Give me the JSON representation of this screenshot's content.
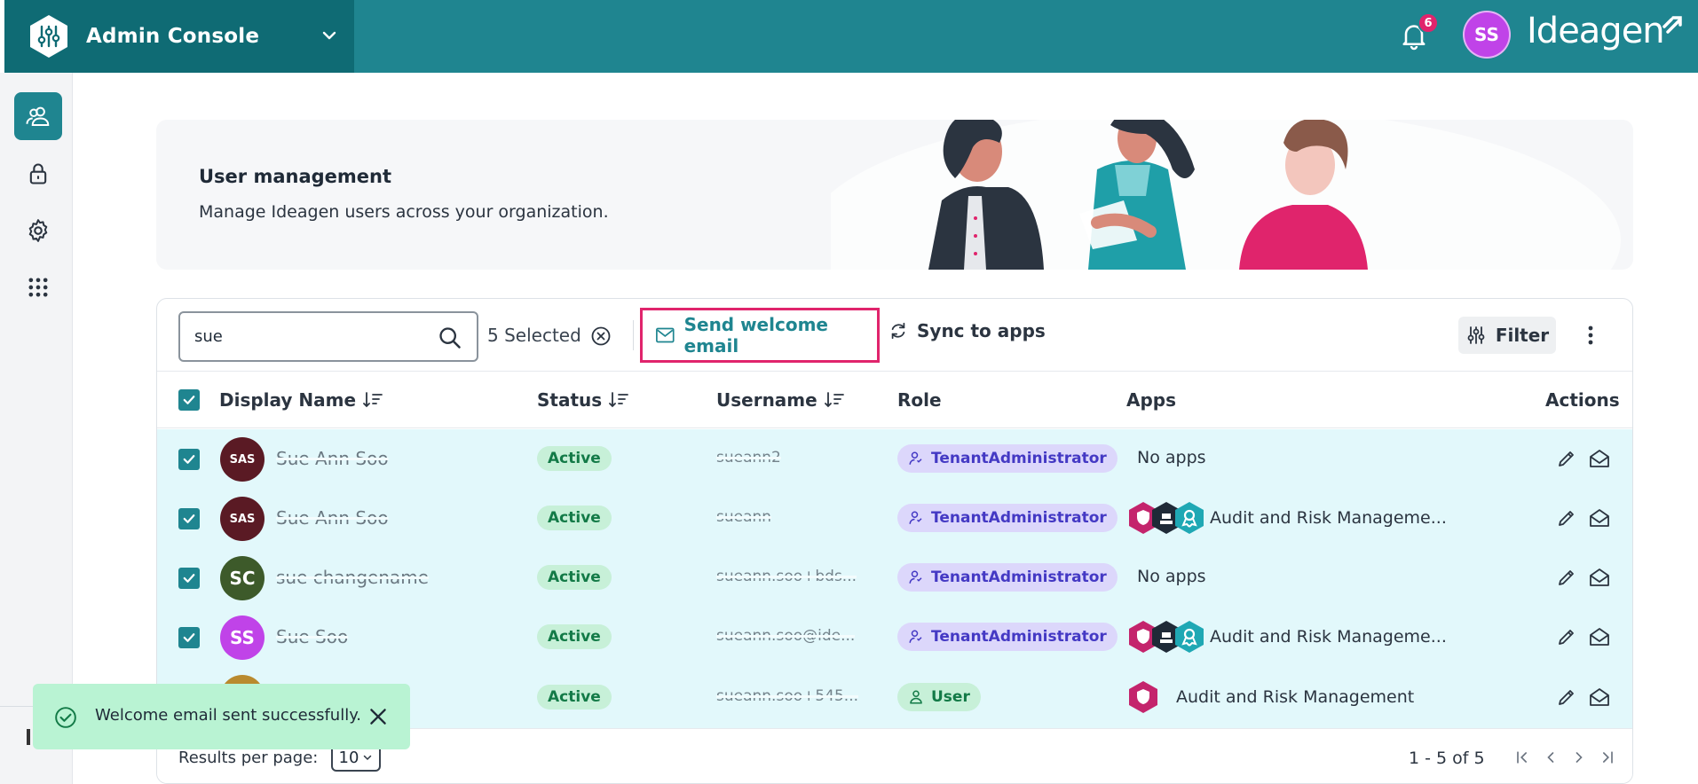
{
  "header": {
    "app_title": "Admin Console",
    "notifications_count": "6",
    "user_initials": "SS",
    "brand": "Ideagen"
  },
  "sidebar": {
    "items": [
      {
        "name": "users-icon",
        "active": true
      },
      {
        "name": "lock-icon",
        "active": false
      },
      {
        "name": "gear-icon",
        "active": false
      },
      {
        "name": "apps-grid-icon",
        "active": false
      }
    ]
  },
  "banner": {
    "title": "User management",
    "subtitle": "Manage Ideagen users across your organization."
  },
  "toolbar": {
    "search_value": "sue",
    "selected_label": "5 Selected",
    "send_welcome_label": "Send welcome email",
    "sync_label": "Sync to apps",
    "filter_label": "Filter"
  },
  "table": {
    "headers": {
      "display_name": "Display Name",
      "status": "Status",
      "username": "Username",
      "role": "Role",
      "apps": "Apps",
      "actions": "Actions"
    },
    "rows": [
      {
        "initials": "SAS",
        "avatar_color": "#5a1a24",
        "name": "Sue Ann Soo",
        "status": "Active",
        "username": "sueann2",
        "role": "TenantAdministrator",
        "role_type": "admin",
        "apps": "No apps",
        "app_icons": 0
      },
      {
        "initials": "SAS",
        "avatar_color": "#5a1a24",
        "name": "Sue Ann Soo",
        "status": "Active",
        "username": "sueann",
        "role": "TenantAdministrator",
        "role_type": "admin",
        "apps": "Audit and Risk Manageme...",
        "app_icons": 3
      },
      {
        "initials": "SC",
        "avatar_color": "#3d5a2a",
        "name": "sue changename",
        "status": "Active",
        "username": "sueann.soo+bds...",
        "role": "TenantAdministrator",
        "role_type": "admin",
        "apps": "No apps",
        "app_icons": 0
      },
      {
        "initials": "SS",
        "avatar_color": "#c043e8",
        "name": "Sue Soo",
        "status": "Active",
        "username": "sueann.soo@ide...",
        "role": "TenantAdministrator",
        "role_type": "admin",
        "apps": "Audit and Risk Manageme...",
        "app_icons": 3
      },
      {
        "initials": "",
        "avatar_color": "#b98a2e",
        "name": "",
        "status": "Active",
        "username": "sueann.soo+545...",
        "role": "User",
        "role_type": "user",
        "apps": "Audit and Risk Management",
        "app_icons": 1
      }
    ]
  },
  "footer": {
    "results_per_page_label": "Results per page:",
    "results_per_page_value": "10",
    "range_label": "1 - 5 of 5"
  },
  "toast": {
    "message": "Welcome email sent successfully."
  },
  "colors": {
    "primary": "#1f8590",
    "primary_dark": "#0f6b74",
    "highlight": "#e0246c",
    "row_selected": "#e2f8fb",
    "success_bg": "#b9f3d3"
  }
}
